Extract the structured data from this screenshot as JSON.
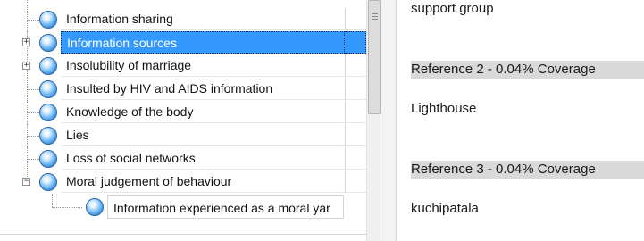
{
  "tree": {
    "rows": [
      {
        "label": "Information sharing",
        "expander": "",
        "selected": false
      },
      {
        "label": "Information sources",
        "expander": "+",
        "selected": true
      },
      {
        "label": "Insolubility of marriage",
        "expander": "+",
        "selected": false
      },
      {
        "label": "Insulted by HIV and AIDS information",
        "expander": "",
        "selected": false
      },
      {
        "label": "Knowledge of the body",
        "expander": "",
        "selected": false
      },
      {
        "label": "Lies",
        "expander": "",
        "selected": false
      },
      {
        "label": "Loss of social networks",
        "expander": "",
        "selected": false
      },
      {
        "label": "Moral judgement of behaviour",
        "expander": "−",
        "selected": false
      }
    ],
    "child_row": {
      "label": "Information experienced as a moral yar"
    }
  },
  "document": {
    "lines": [
      {
        "kind": "text",
        "text": "support group"
      },
      {
        "kind": "reference",
        "text": "Reference 2 - 0.04% Coverage"
      },
      {
        "kind": "text",
        "text": "Lighthouse"
      },
      {
        "kind": "reference",
        "text": "Reference 3 - 0.04% Coverage"
      },
      {
        "kind": "text",
        "text": "kuchipatala"
      }
    ]
  }
}
